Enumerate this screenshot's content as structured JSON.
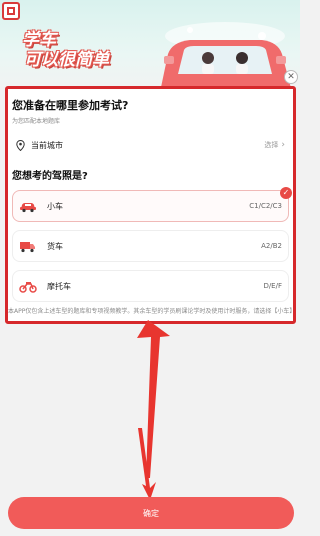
{
  "hero": {
    "title_line1": "学车",
    "title_line2": "可以很简单"
  },
  "location": {
    "question": "您准备在哪里参加考试?",
    "subtitle": "为您匹配本地题库",
    "city_label": "当前城市",
    "city_action": "选择"
  },
  "license": {
    "question": "您想考的驾照是?",
    "options": [
      {
        "name": "小车",
        "code": "C1/C2/C3",
        "selected": true
      },
      {
        "name": "货车",
        "code": "A2/B2",
        "selected": false
      },
      {
        "name": "摩托车",
        "code": "D/E/F",
        "selected": false
      }
    ]
  },
  "disclaimer": "本APP仅包含上述车型的题库和专项视频教学。其余车型的学员刷课论学时及使用计时服务，请选择【小车】",
  "confirm_label": "确定",
  "colors": {
    "accent": "#f15b59",
    "highlight_border": "#d6282b",
    "arrow": "#e8352f"
  }
}
